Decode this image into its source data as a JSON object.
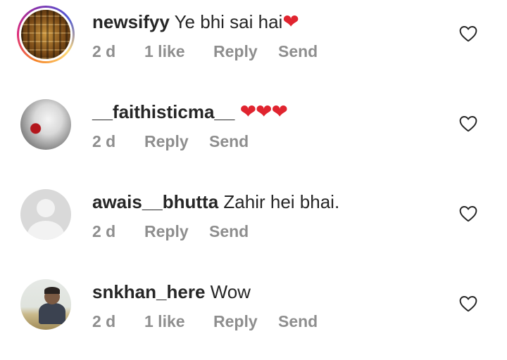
{
  "comments": [
    {
      "username": "newsifyy",
      "text": "Ye bhi sai hai",
      "hearts": "❤",
      "time": "2 d",
      "likes": "1 like",
      "reply": "Reply",
      "send": "Send",
      "like_icon": "heart-outline-icon"
    },
    {
      "username": "__faithisticma__",
      "text": "",
      "hearts": "❤❤❤",
      "time": "2 d",
      "reply": "Reply",
      "send": "Send",
      "like_icon": "heart-outline-icon"
    },
    {
      "username": "awais__bhutta",
      "text": "Zahir hei bhai.",
      "time": "2 d",
      "reply": "Reply",
      "send": "Send",
      "like_icon": "heart-outline-icon"
    },
    {
      "username": "snkhan_here",
      "text": "Wow",
      "time": "2 d",
      "likes": "1 like",
      "reply": "Reply",
      "send": "Send",
      "like_icon": "heart-outline-icon"
    }
  ],
  "colors": {
    "heart_emoji": "#e0242f",
    "meta_text": "#8e8e8e",
    "primary_text": "#262626"
  }
}
